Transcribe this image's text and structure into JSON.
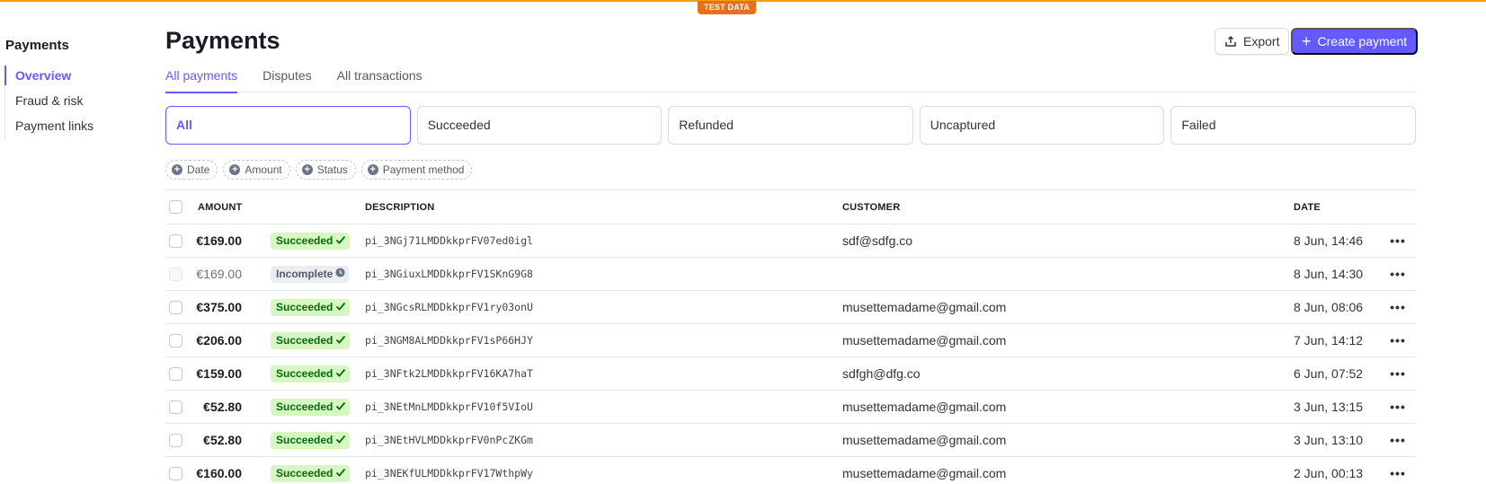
{
  "banner": {
    "label": "TEST DATA",
    "color": "#e56f1b"
  },
  "sidebar": {
    "title": "Payments",
    "items": [
      {
        "label": "Overview",
        "active": true
      },
      {
        "label": "Fraud & risk",
        "active": false
      },
      {
        "label": "Payment links",
        "active": false
      }
    ]
  },
  "header": {
    "title": "Payments",
    "export_label": "Export",
    "create_label": "Create payment",
    "accent": "#635bff"
  },
  "tabs": [
    {
      "label": "All payments",
      "active": true
    },
    {
      "label": "Disputes",
      "active": false
    },
    {
      "label": "All transactions",
      "active": false
    }
  ],
  "status_filters": [
    {
      "label": "All",
      "active": true
    },
    {
      "label": "Succeeded",
      "active": false
    },
    {
      "label": "Refunded",
      "active": false
    },
    {
      "label": "Uncaptured",
      "active": false
    },
    {
      "label": "Failed",
      "active": false
    }
  ],
  "filter_chips": [
    "Date",
    "Amount",
    "Status",
    "Payment method"
  ],
  "table": {
    "columns": {
      "amount": "AMOUNT",
      "description": "DESCRIPTION",
      "customer": "CUSTOMER",
      "date": "DATE"
    },
    "rows": [
      {
        "amount": "€169.00",
        "status": "Succeeded",
        "status_type": "success",
        "description": "pi_3NGj71LMDDkkprFV07ed0igl",
        "customer": "sdf@sdfg.co",
        "date": "8 Jun, 14:46"
      },
      {
        "amount": "€169.00",
        "status": "Incomplete",
        "status_type": "incomplete",
        "description": "pi_3NGiuxLMDDkkprFV1SKnG9G8",
        "customer": "",
        "date": "8 Jun, 14:30"
      },
      {
        "amount": "€375.00",
        "status": "Succeeded",
        "status_type": "success",
        "description": "pi_3NGcsRLMDDkkprFV1ry03onU",
        "customer": "musettemadame@gmail.com",
        "date": "8 Jun, 08:06"
      },
      {
        "amount": "€206.00",
        "status": "Succeeded",
        "status_type": "success",
        "description": "pi_3NGM8ALMDDkkprFV1sP66HJY",
        "customer": "musettemadame@gmail.com",
        "date": "7 Jun, 14:12"
      },
      {
        "amount": "€159.00",
        "status": "Succeeded",
        "status_type": "success",
        "description": "pi_3NFtk2LMDDkkprFV16KA7haT",
        "customer": "sdfgh@dfg.co",
        "date": "6 Jun, 07:52"
      },
      {
        "amount": "€52.80",
        "status": "Succeeded",
        "status_type": "success",
        "description": "pi_3NEtMnLMDDkkprFV10f5VIoU",
        "customer": "musettemadame@gmail.com",
        "date": "3 Jun, 13:15"
      },
      {
        "amount": "€52.80",
        "status": "Succeeded",
        "status_type": "success",
        "description": "pi_3NEtHVLMDDkkprFV0nPcZKGm",
        "customer": "musettemadame@gmail.com",
        "date": "3 Jun, 13:10"
      },
      {
        "amount": "€160.00",
        "status": "Succeeded",
        "status_type": "success",
        "description": "pi_3NEKfULMDDkkprFV17WthpWy",
        "customer": "musettemadame@gmail.com",
        "date": "2 Jun, 00:13"
      }
    ]
  }
}
